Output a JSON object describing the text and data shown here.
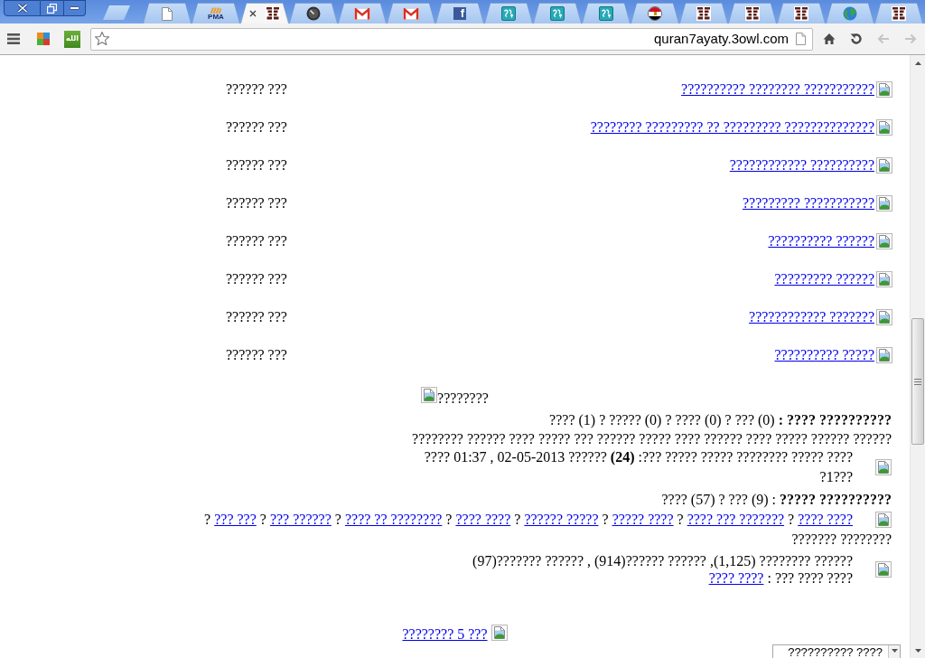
{
  "tabs": [
    {
      "kind": "page",
      "selected": false
    },
    {
      "kind": "logo_text",
      "icon_text": "PMA",
      "selected": false
    },
    {
      "kind": "pattern",
      "selected": true
    },
    {
      "kind": "gauge",
      "selected": false
    },
    {
      "kind": "mail",
      "selected": false
    },
    {
      "kind": "mail",
      "selected": false
    },
    {
      "kind": "letter_tile",
      "icon_text": "f",
      "selected": false
    },
    {
      "kind": "script_tile",
      "selected": false
    },
    {
      "kind": "script_tile",
      "selected": false
    },
    {
      "kind": "script_tile",
      "selected": false
    },
    {
      "kind": "flag",
      "selected": false
    },
    {
      "kind": "pattern",
      "selected": false
    },
    {
      "kind": "pattern",
      "selected": false
    },
    {
      "kind": "pattern",
      "selected": false
    },
    {
      "kind": "globe",
      "selected": false
    },
    {
      "kind": "pattern",
      "selected": false
    }
  ],
  "toolbar": {
    "extension_label": "الله",
    "url": "quran7ayaty.3owl.com",
    "nav_buttons": [
      {
        "kind": "home",
        "disabled": false
      },
      {
        "kind": "reload",
        "disabled": false
      },
      {
        "kind": "back",
        "disabled": true
      },
      {
        "kind": "forward",
        "disabled": true
      }
    ]
  },
  "link_rows": [
    {
      "link": "?????????? ???????? ???????????",
      "text": "?????? ???"
    },
    {
      "link": "???????? ????????? ?? ????????? ??????????????",
      "text": "?????? ???"
    },
    {
      "link": "???????????? ??????????",
      "text": "?????? ???"
    },
    {
      "link": "????????? ???????????",
      "text": "?????? ???"
    },
    {
      "link": "?????????? ??????",
      "text": "?????? ???"
    },
    {
      "link": "????????? ??????",
      "text": "?????? ???"
    },
    {
      "link": "???????????? ???????",
      "text": "?????? ???"
    },
    {
      "link": "?????????? ?????",
      "text": "?????? ???"
    }
  ],
  "featured_heading": "????????",
  "category_stats": "???? (1) ? ????? (0) ? ???? (0) ? ??? (0) **: ???? ??????????**",
  "description": "???????? ?????? ???? ????? ??? ?????? ????? ???? ?????? ???? ????? ?????? ??????",
  "latest_post": {
    "lines": [
      "???? 01:37 , 02-05-2013 ?????? **(24)** :??? ????? ????? ???????? ????? ????",
      "?1???"
    ]
  },
  "comment_stats": "???? (57) ? ??? (9) : **????? ??????????**",
  "tags": {
    "items": [
      {
        "separator": "?",
        "label": "??? ???"
      },
      {
        "separator": "?",
        "label": "??? ??????"
      },
      {
        "separator": "?",
        "label": "???? ?? ????????"
      },
      {
        "separator": "?",
        "label": "???? ????"
      },
      {
        "separator": "?",
        "label": "?????? ?????"
      },
      {
        "separator": "?",
        "label": "????? ????"
      },
      {
        "separator": "?",
        "label": "???? ??? ???????"
      },
      {
        "separator": "?",
        "label": "???? ????"
      }
    ],
    "title": "??????? ????????"
  },
  "site_stats": {
    "line": "(97)??????? ?????? , (914)?????? ?????? ,(1,125) ???????? ??????",
    "link": "???? ????",
    "text": ": ??? ???? ????"
  },
  "more_link": "???????? 5 ???",
  "dropdown": {
    "value": "?????????? ????"
  }
}
